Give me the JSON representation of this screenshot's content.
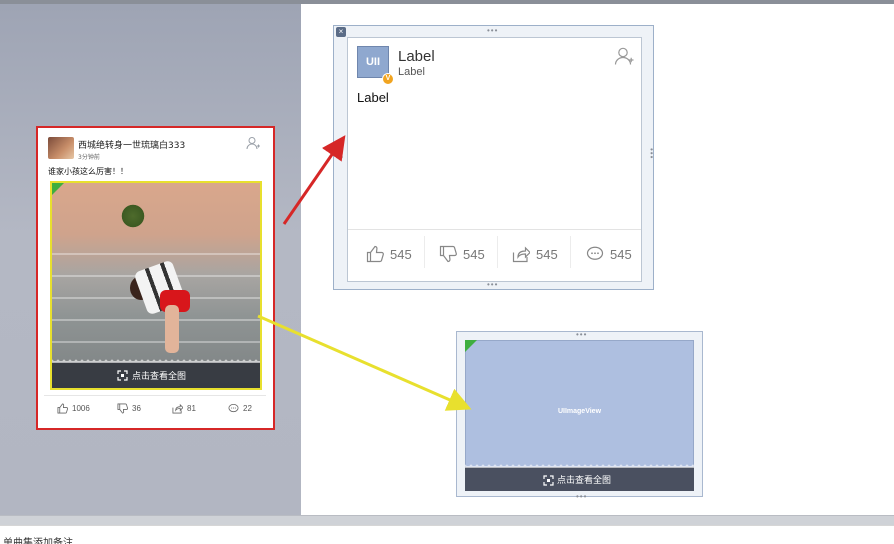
{
  "status_bar": {
    "text": "单曲集添加备注"
  },
  "preview_card": {
    "username": "西城绝转身一世琉璃白333",
    "time": "3分钟前",
    "content": "谁家小孩这么厉害！！",
    "overlay_text": "点击查看全图",
    "stats": {
      "likes": "1006",
      "dislikes": "36",
      "shares": "81",
      "comments": "22"
    }
  },
  "ib_cell": {
    "avatar_text": "UII",
    "badge_text": "V",
    "name_label": "Label",
    "sub_label": "Label",
    "body_label": "Label",
    "stats": {
      "likes": "545",
      "dislikes": "545",
      "shares": "545",
      "comments": "545"
    }
  },
  "image_view": {
    "placeholder": "UIImageView",
    "overlay_text": "点击查看全图"
  },
  "colors": {
    "highlight_red": "#d62727",
    "highlight_yellow": "#e8e02e",
    "accent_badge": "#f1a420",
    "placeholder_blue": "#aebfe0"
  },
  "icons": [
    "like-icon",
    "dislike-icon",
    "share-icon",
    "comment-icon",
    "add-friend-icon",
    "fullscreen-icon",
    "close-icon"
  ]
}
